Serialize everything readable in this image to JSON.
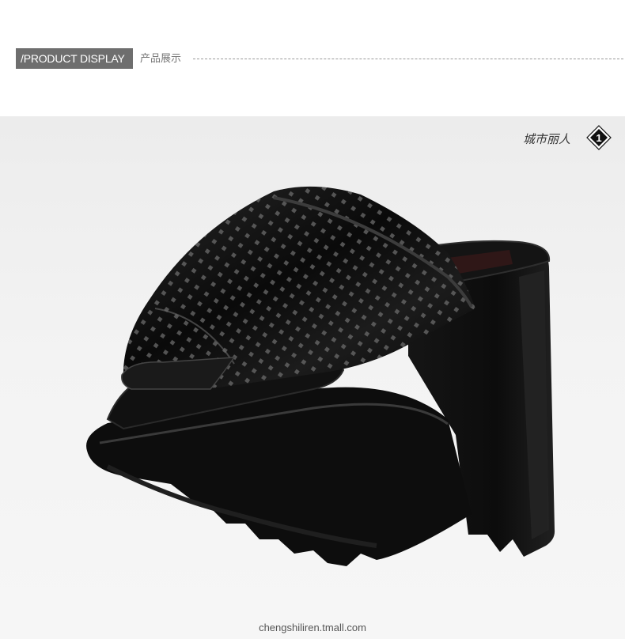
{
  "header": {
    "title": "/PRODUCT DISPLAY",
    "subtitle": "产品展示"
  },
  "brand": {
    "logo_text": "城市丽人",
    "badge_number": "1"
  },
  "footer": {
    "url": "chengshiliren.tmall.com"
  },
  "colors": {
    "header_tab": "#6e6e6e",
    "stage_background": "#efefef",
    "shoe": "#0c0c0c"
  },
  "product_image": {
    "subject": "black-patent-platform-mule-icon"
  }
}
